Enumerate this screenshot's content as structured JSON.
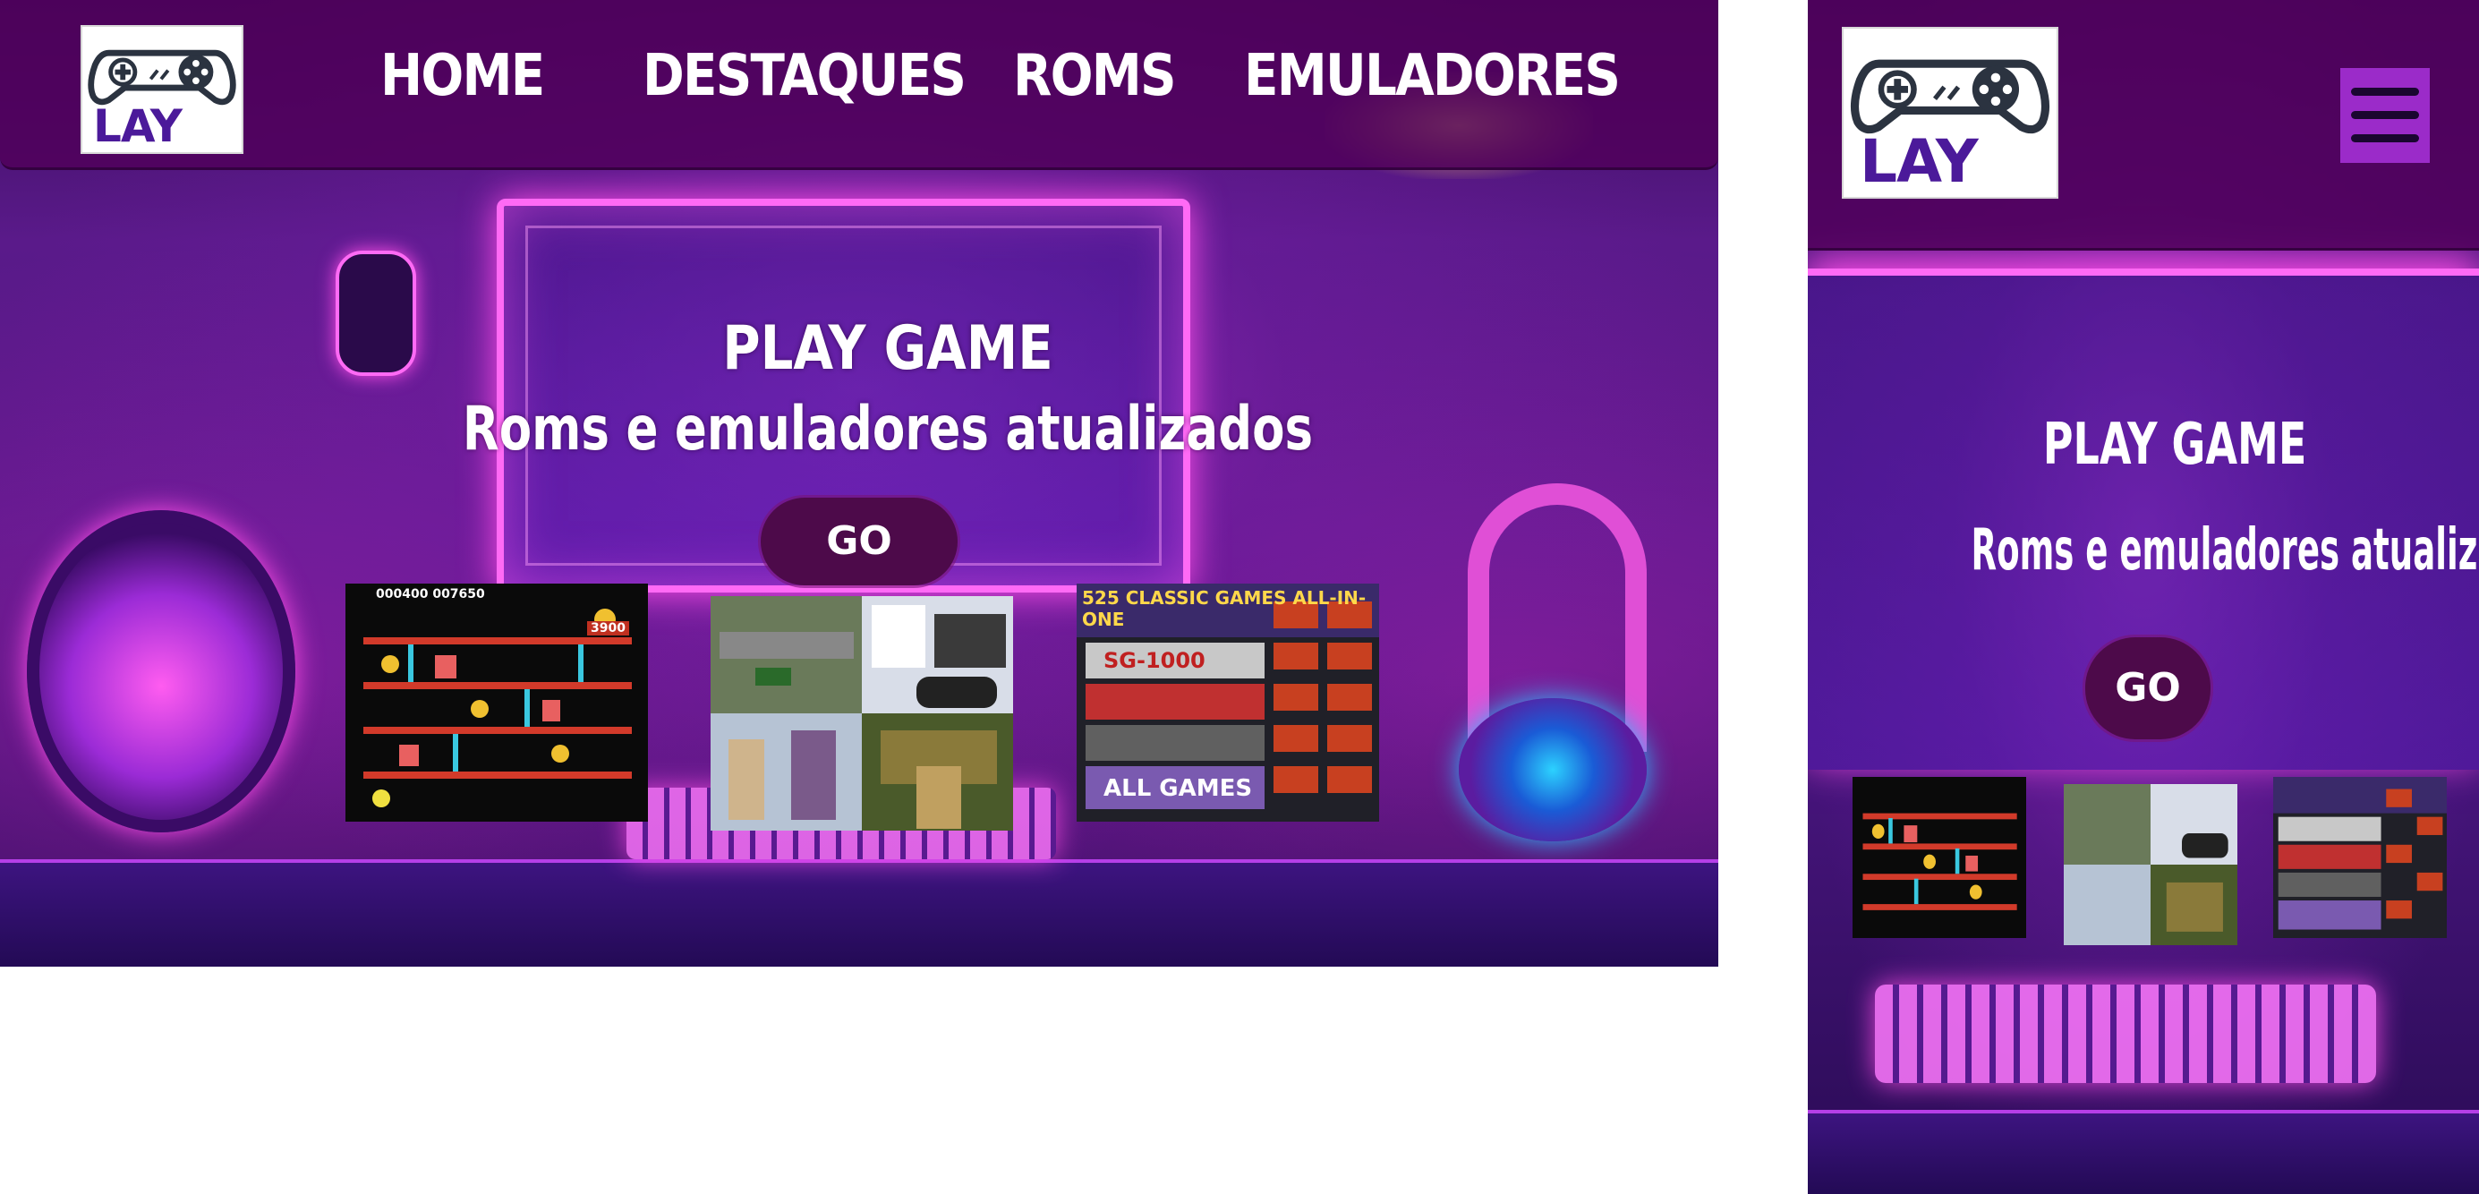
{
  "colors": {
    "navbar": "#50005a",
    "button_bg": "#4d0a4a",
    "logo_text": "#4b1a9a",
    "hamburger_bg": "#9b2bc9",
    "neon_pink": "#ff6af5"
  },
  "logo": {
    "text": "LAY",
    "icon": "gamepad-icon"
  },
  "desktop": {
    "nav": {
      "items": [
        {
          "label": "HOME"
        },
        {
          "label": "DESTAQUES"
        },
        {
          "label": "ROMS"
        },
        {
          "label": "EMULADORES"
        }
      ]
    },
    "hero": {
      "title": "PLAY GAME",
      "subtitle": "Roms e emuladores atualizados",
      "button_label": "GO"
    }
  },
  "mobile": {
    "menu_icon": "hamburger-menu-icon",
    "hero": {
      "title": "PLAY GAME",
      "subtitle": "Roms e emuladores atualizados",
      "button_label": "GO"
    }
  },
  "thumbnails": [
    {
      "name": "arcade-collage",
      "text_top": "000400   007650",
      "text_side": "3900"
    },
    {
      "name": "emulator-gameplay-collage"
    },
    {
      "name": "classic-games-collection",
      "title": "525 CLASSIC GAMES ALL-IN-ONE",
      "badge": "SG-1000",
      "footer": "ALL GAMES"
    }
  ]
}
